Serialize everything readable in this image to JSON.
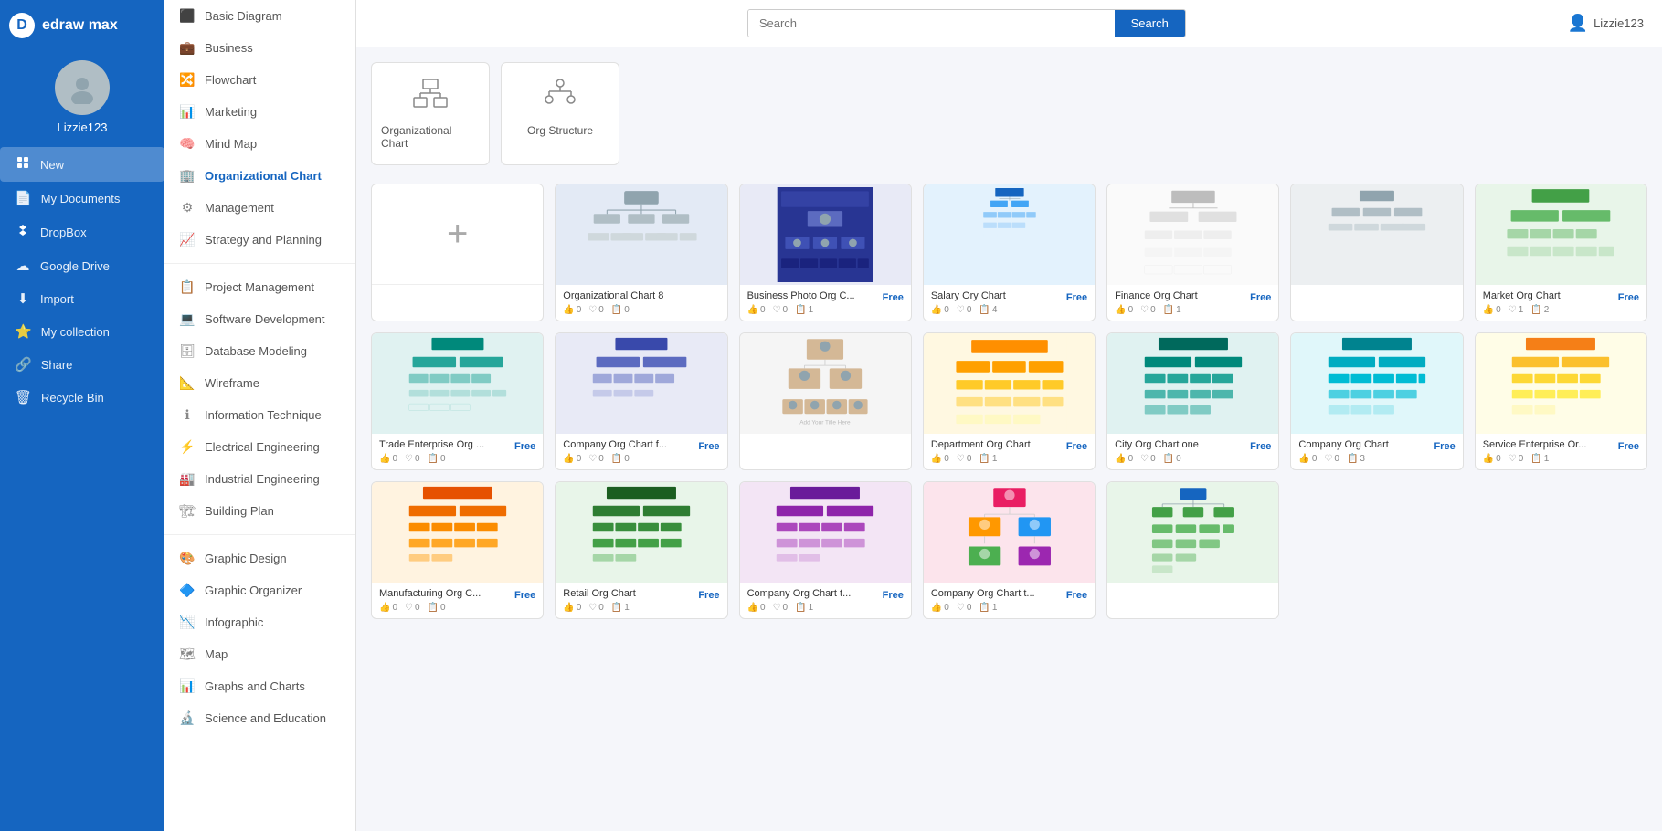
{
  "app": {
    "name": "edraw max",
    "logo_symbol": "D"
  },
  "user": {
    "name": "Lizzie123"
  },
  "search": {
    "placeholder": "Search",
    "button_label": "Search"
  },
  "sidebar_nav": [
    {
      "id": "new",
      "label": "New",
      "icon": "🆕",
      "active": true
    },
    {
      "id": "my-documents",
      "label": "My Documents",
      "icon": "📄"
    },
    {
      "id": "dropbox",
      "label": "DropBox",
      "icon": "📦"
    },
    {
      "id": "google-drive",
      "label": "Google Drive",
      "icon": "☁"
    },
    {
      "id": "import",
      "label": "Import",
      "icon": "⬇"
    },
    {
      "id": "my-collection",
      "label": "My collection",
      "icon": "⭐"
    },
    {
      "id": "share",
      "label": "Share",
      "icon": "🔗"
    },
    {
      "id": "recycle-bin",
      "label": "Recycle Bin",
      "icon": "🗑"
    }
  ],
  "middle_nav": [
    {
      "id": "basic-diagram",
      "label": "Basic Diagram",
      "icon": "⬛",
      "active": false
    },
    {
      "id": "business",
      "label": "Business",
      "icon": "💼",
      "active": false
    },
    {
      "id": "flowchart",
      "label": "Flowchart",
      "icon": "🔀",
      "active": false
    },
    {
      "id": "marketing",
      "label": "Marketing",
      "icon": "📊",
      "active": false
    },
    {
      "id": "mind-map",
      "label": "Mind Map",
      "icon": "🧠",
      "active": false
    },
    {
      "id": "organizational-chart",
      "label": "Organizational Chart",
      "icon": "🏢",
      "active": true
    },
    {
      "id": "management",
      "label": "Management",
      "icon": "⚙",
      "active": false
    },
    {
      "id": "strategy-and-planning",
      "label": "Strategy and Planning",
      "icon": "📈",
      "active": false
    },
    {
      "id": "project-management",
      "label": "Project Management",
      "icon": "📋",
      "active": false
    },
    {
      "id": "software-development",
      "label": "Software Development",
      "icon": "💻",
      "active": false
    },
    {
      "id": "database-modeling",
      "label": "Database Modeling",
      "icon": "🗄",
      "active": false
    },
    {
      "id": "wireframe",
      "label": "Wireframe",
      "icon": "📐",
      "active": false
    },
    {
      "id": "information-technique",
      "label": "Information Technique",
      "icon": "ℹ",
      "active": false
    },
    {
      "id": "electrical-engineering",
      "label": "Electrical Engineering",
      "icon": "⚡",
      "active": false
    },
    {
      "id": "industrial-engineering",
      "label": "Industrial Engineering",
      "icon": "🏭",
      "active": false
    },
    {
      "id": "building-plan",
      "label": "Building Plan",
      "icon": "🏗",
      "active": false
    },
    {
      "id": "graphic-design",
      "label": "Graphic Design",
      "icon": "🎨",
      "active": false
    },
    {
      "id": "graphic-organizer",
      "label": "Graphic Organizer",
      "icon": "🔷",
      "active": false
    },
    {
      "id": "infographic",
      "label": "Infographic",
      "icon": "📉",
      "active": false
    },
    {
      "id": "map",
      "label": "Map",
      "icon": "🗺",
      "active": false
    },
    {
      "id": "graphs-and-charts",
      "label": "Graphs and Charts",
      "icon": "📊",
      "active": false
    },
    {
      "id": "science-and-education",
      "label": "Science and Education",
      "icon": "🔬",
      "active": false
    }
  ],
  "category_cards": [
    {
      "id": "organizational-chart",
      "label": "Organizational Chart",
      "icon": "🏢"
    },
    {
      "id": "org-structure",
      "label": "Org Structure",
      "icon": "🔗"
    }
  ],
  "templates": [
    {
      "id": "new",
      "title": "",
      "badge": "",
      "type": "new",
      "likes": "",
      "hearts": "",
      "copies": ""
    },
    {
      "id": "organizational-chart-8",
      "title": "Organizational Chart 8",
      "badge": "",
      "type": "light-blue",
      "likes": "0",
      "hearts": "0",
      "copies": "0"
    },
    {
      "id": "business-photo-org",
      "title": "Business Photo Org C...",
      "badge": "Free",
      "type": "pink-blue",
      "likes": "0",
      "hearts": "0",
      "copies": "1"
    },
    {
      "id": "salary-ory-chart",
      "title": "Salary Ory Chart",
      "badge": "Free",
      "type": "dark-blue",
      "likes": "0",
      "hearts": "0",
      "copies": "4"
    },
    {
      "id": "finance-org-chart",
      "title": "Finance Org Chart",
      "badge": "Free",
      "type": "gray-chart",
      "likes": "0",
      "hearts": "0",
      "copies": "1"
    },
    {
      "id": "unknown1",
      "title": "",
      "badge": "",
      "type": "gray-small",
      "likes": "",
      "hearts": "",
      "copies": ""
    },
    {
      "id": "market-org-chart",
      "title": "Market Org Chart",
      "badge": "Free",
      "type": "green-chart",
      "likes": "0",
      "hearts": "1",
      "copies": "2"
    },
    {
      "id": "trade-enterprise-org",
      "title": "Trade Enterprise Org ...",
      "badge": "Free",
      "type": "teal-chart",
      "likes": "0",
      "hearts": "0",
      "copies": "0"
    },
    {
      "id": "company-org-chart-f",
      "title": "Company Org Chart f...",
      "badge": "Free",
      "type": "blue-small",
      "likes": "0",
      "hearts": "0",
      "copies": "0"
    },
    {
      "id": "unknown2",
      "title": "",
      "badge": "",
      "type": "photo-chart",
      "likes": "",
      "hearts": "",
      "copies": ""
    },
    {
      "id": "department-org-chart",
      "title": "Department Org Chart",
      "badge": "Free",
      "type": "orange-chart",
      "likes": "0",
      "hearts": "0",
      "copies": "1"
    },
    {
      "id": "city-org-chart-one",
      "title": "City Org Chart one",
      "badge": "Free",
      "type": "teal2-chart",
      "likes": "0",
      "hearts": "0",
      "copies": "0"
    },
    {
      "id": "company-org-chart",
      "title": "Company Org Chart",
      "badge": "Free",
      "type": "teal3-chart",
      "likes": "0",
      "hearts": "0",
      "copies": "3"
    },
    {
      "id": "service-enterprise-or",
      "title": "Service Enterprise Or...",
      "badge": "Free",
      "type": "yellow-chart",
      "likes": "0",
      "hearts": "0",
      "copies": "1"
    },
    {
      "id": "manufacturing-org-c",
      "title": "Manufacturing Org C...",
      "badge": "Free",
      "type": "mfg-chart",
      "likes": "0",
      "hearts": "0",
      "copies": "0"
    },
    {
      "id": "retail-org-chart",
      "title": "Retail Org Chart",
      "badge": "Free",
      "type": "retail-chart",
      "likes": "0",
      "hearts": "0",
      "copies": "1"
    },
    {
      "id": "company-org-chart-t1",
      "title": "Company Org Chart t...",
      "badge": "Free",
      "type": "light-chart",
      "likes": "0",
      "hearts": "0",
      "copies": "1"
    },
    {
      "id": "company-org-chart-t2",
      "title": "Company Org Chart t...",
      "badge": "Free",
      "type": "colorful-chart",
      "likes": "0",
      "hearts": "0",
      "copies": "1"
    },
    {
      "id": "unknown3",
      "title": "",
      "badge": "",
      "type": "green-tree",
      "likes": "",
      "hearts": "",
      "copies": ""
    }
  ]
}
